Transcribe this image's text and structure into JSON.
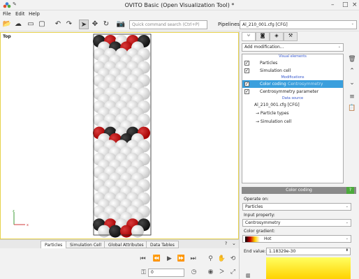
{
  "window": {
    "title": "OVITO Basic (Open Visualization Tool) *"
  },
  "menu": {
    "file": "File",
    "edit": "Edit",
    "help": "Help"
  },
  "toolbar": {
    "command_search_placeholder": "Quick command search (Ctrl+P)",
    "pipelines_label": "Pipelines:",
    "pipeline_selected": "Al_210_001.cfg [CFG]"
  },
  "viewport": {
    "label": "Top",
    "axis_x": "x",
    "axis_z": "z"
  },
  "bottom_tabs": [
    "Particles",
    "Simulation Cell",
    "Global Attributes",
    "Data Tables"
  ],
  "animation": {
    "frame": "0"
  },
  "pipeline_panel": {
    "add_modification": "Add modification...",
    "sections": {
      "visual": "Visual elements",
      "modifications": "Modifications",
      "source": "Data source"
    },
    "visual_items": [
      "Particles",
      "Simulation cell"
    ],
    "modification_items": [
      "Color coding",
      "Centrosymmetry parameter"
    ],
    "selected_suffix": "Centrosymmetry",
    "source_title": "Al_210_001.cfg [CFG]",
    "source_items": [
      "→ Particle types",
      "→ Simulation cell"
    ]
  },
  "color_coding": {
    "header": "Color coding",
    "help": "?",
    "operate_on_label": "Operate on:",
    "operate_on_value": "Particles",
    "input_property_label": "Input property:",
    "input_property_value": "Centrosymmetry",
    "gradient_label": "Color gradient:",
    "gradient_value": "Hot",
    "end_value_label": "End value:",
    "end_value": "1.18329e-30"
  },
  "colors": {
    "accent_selected": "#3a9fdd",
    "viewport_border": "#e7d24a",
    "particle_red": "#a40000",
    "particle_black": "#111111",
    "particle_white": "#f4f4f4"
  }
}
